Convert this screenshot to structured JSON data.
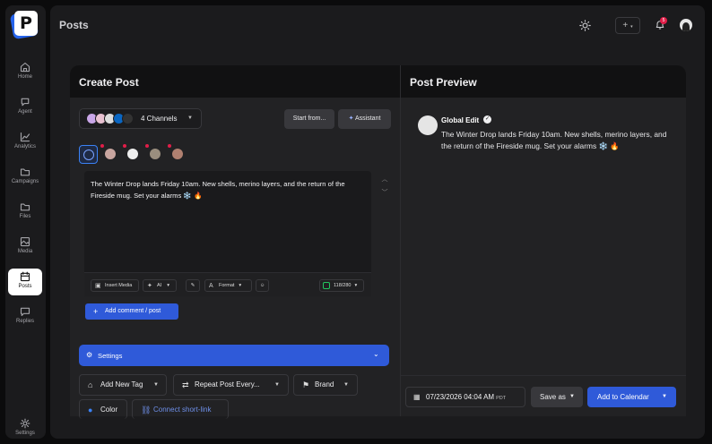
{
  "sidebar": {
    "logo_letter": "P",
    "items": [
      {
        "label": "Home",
        "icon": "home-icon"
      },
      {
        "label": "Agent",
        "icon": "agent-icon"
      },
      {
        "label": "Analytics",
        "icon": "analytics-icon"
      },
      {
        "label": "Campaigns",
        "icon": "folder-icon"
      },
      {
        "label": "Files",
        "icon": "folder-icon"
      },
      {
        "label": "Media",
        "icon": "image-icon"
      },
      {
        "label": "Posts",
        "icon": "calendar-icon",
        "active": true
      },
      {
        "label": "Replies",
        "icon": "chat-icon"
      }
    ],
    "settings_label": "Settings"
  },
  "header": {
    "title": "Posts",
    "plus_label": "+",
    "notification_count": "5"
  },
  "create_post": {
    "title": "Create Post",
    "channels_label": "4 Channels",
    "start_from_label": "Start from...",
    "assistant_label": "Assistant",
    "post_text": "The Winter Drop lands Friday 10am. New shells, merino layers, and the return of the Fireside mug. Set your alarms ❄️ 🔥",
    "toolbar": {
      "insert_media": "Insert Media",
      "ai": "AI",
      "format": "Format",
      "char_count": "118/280"
    },
    "add_comment_label": "Add comment / post",
    "settings_label": "Settings",
    "options": {
      "add_tag": "Add New Tag",
      "repeat": "Repeat Post Every...",
      "brand": "Brand",
      "color": "Color",
      "short_link": "Connect short-link"
    }
  },
  "preview": {
    "title": "Post Preview",
    "account_name": "Global Edit",
    "text": "The Winter Drop lands Friday 10am. New shells, merino layers, and the return of the Fireside mug. Set your alarms ❄️ 🔥",
    "date": "07/23/2026 04:04 AM",
    "timezone": "PDT",
    "save_as_label": "Save as",
    "add_calendar_label": "Add to Calendar"
  },
  "colors": {
    "accent": "#2f5ad9",
    "background": "#0b0b0c",
    "panel": "#222224",
    "badge": "#e11d48"
  }
}
